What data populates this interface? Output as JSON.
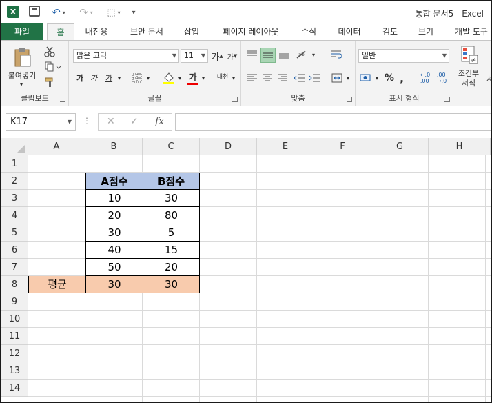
{
  "app": {
    "logo": "X",
    "title": "통합 문서5 - Excel"
  },
  "quick_access": {
    "undo_icon": "↶",
    "redo_icon": "↷",
    "select_icon": "⬚",
    "customize_icon": "▾"
  },
  "tabs": [
    {
      "label": "파일"
    },
    {
      "label": "홈"
    },
    {
      "label": "내전용"
    },
    {
      "label": "보안 문서"
    },
    {
      "label": "삽입"
    },
    {
      "label": "페이지 레이아웃"
    },
    {
      "label": "수식"
    },
    {
      "label": "데이터"
    },
    {
      "label": "검토"
    },
    {
      "label": "보기"
    },
    {
      "label": "개발 도구"
    }
  ],
  "ribbon": {
    "clipboard": {
      "label": "클립보드",
      "paste_label": "붙여넣기"
    },
    "font": {
      "label": "글꼴",
      "font_name": "맑은 고딕",
      "font_size": "11",
      "grow": "가",
      "shrink": "가",
      "bold": "가",
      "italic": "가",
      "underline": "가",
      "font_color_glyph": "가",
      "phonetic": "내천"
    },
    "alignment": {
      "label": "맞춤"
    },
    "number": {
      "label": "표시 형식",
      "format": "일반",
      "percent": "%",
      "comma": ",",
      "inc_decimal": "←.0\n.00",
      "dec_decimal": ".00\n→.0"
    },
    "styles": {
      "conditional_format": "조건부\n서식",
      "cut_label": "서"
    }
  },
  "formula_bar": {
    "name_box": "K17",
    "cancel_icon": "✕",
    "enter_icon": "✓",
    "fx_label": "fx",
    "value": ""
  },
  "columns": [
    "A",
    "B",
    "C",
    "D",
    "E",
    "F",
    "G",
    "H"
  ],
  "rows": [
    "1",
    "2",
    "3",
    "4",
    "5",
    "6",
    "7",
    "8",
    "9",
    "10",
    "11",
    "12",
    "13",
    "14"
  ],
  "sheet": {
    "header_b": "A점수",
    "header_c": "B점수",
    "b_values": [
      "10",
      "20",
      "30",
      "40",
      "50"
    ],
    "c_values": [
      "30",
      "80",
      "5",
      "15",
      "20"
    ],
    "avg_label": "평균",
    "avg_b": "30",
    "avg_c": "30"
  },
  "colors": {
    "excel_green": "#217346",
    "header_fill": "#B4C6E7",
    "average_fill": "#F8CBAD"
  }
}
